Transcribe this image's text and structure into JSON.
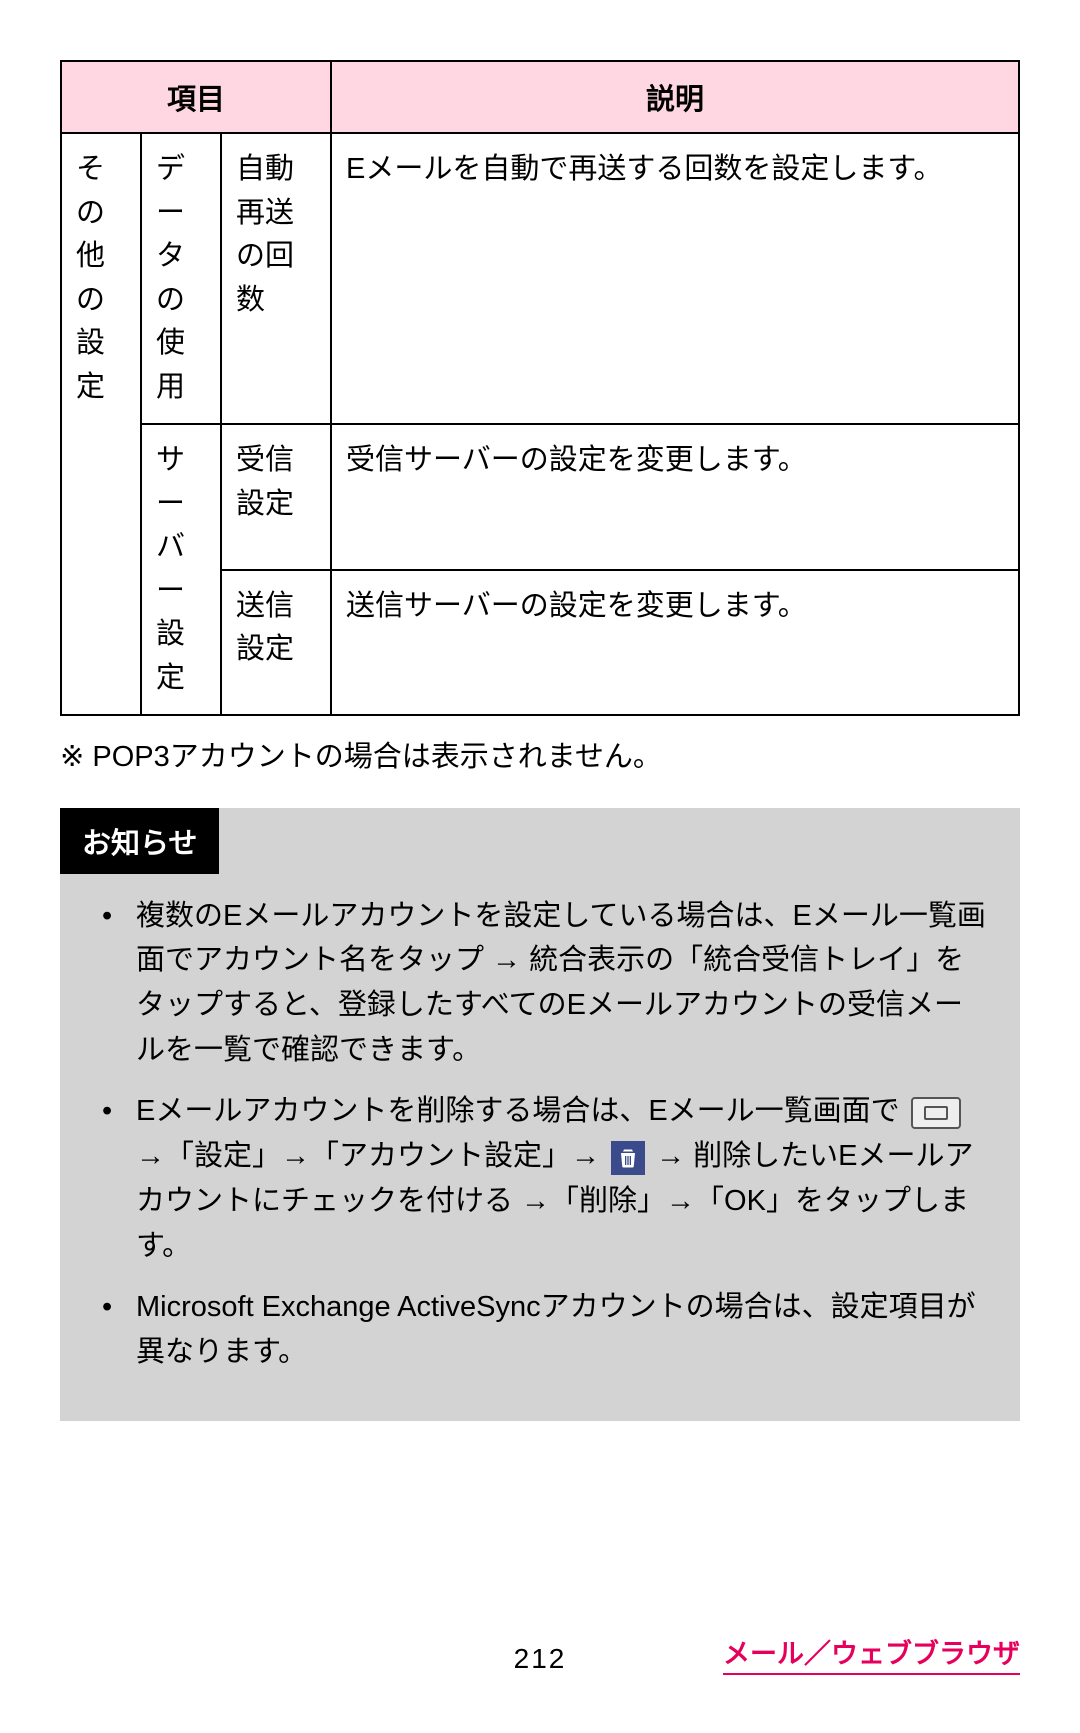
{
  "table": {
    "headers": {
      "item": "項目",
      "desc": "説明"
    },
    "group_label": "その他の設定",
    "rows": [
      {
        "sub1": "データの使用",
        "sub2": "自動再送の回数",
        "desc": "Eメールを自動で再送する回数を設定します。"
      },
      {
        "sub1": "サーバー設定",
        "sub2": "受信設定",
        "desc": "受信サーバーの設定を変更します。"
      },
      {
        "sub2": "送信設定",
        "desc": "送信サーバーの設定を変更します。"
      }
    ]
  },
  "note": "※ POP3アカウントの場合は表示されません。",
  "notice": {
    "title": "お知らせ",
    "items": {
      "i1": "複数のEメールアカウントを設定している場合は、Eメール一覧画面でアカウント名をタップ → 統合表示の「統合受信トレイ」をタップすると、登録したすべてのEメールアカウントの受信メールを一覧で確認できます。",
      "i2a": "Eメールアカウントを削除する場合は、Eメール一覧画面で ",
      "i2b": " →「設定」→「アカウント設定」→ ",
      "i2c": " → 削除したいEメールアカウントにチェックを付ける →「削除」→「OK」をタップします。",
      "i3": "Microsoft Exchange ActiveSyncアカウントの場合は、設定項目が異なります。"
    }
  },
  "footer": {
    "page_number": "212",
    "link": "メール／ウェブブラウザ"
  }
}
